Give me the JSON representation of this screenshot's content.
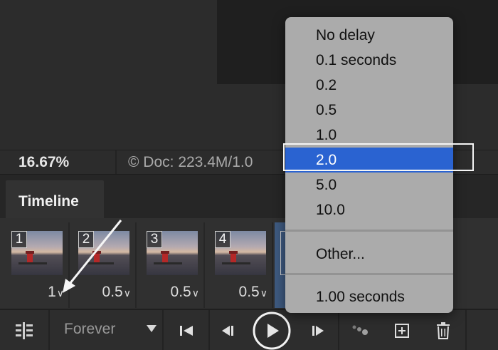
{
  "status": {
    "zoom": "16.67%",
    "doc_info": "© Doc: 223.4M/1.0"
  },
  "timeline": {
    "tab_label": "Timeline",
    "frames": [
      {
        "number": "1",
        "delay": "1"
      },
      {
        "number": "2",
        "delay": "0.5"
      },
      {
        "number": "3",
        "delay": "0.5"
      },
      {
        "number": "4",
        "delay": "0.5"
      }
    ],
    "delay_chevron": "∨",
    "loop_label": "Forever"
  },
  "delay_menu": {
    "items": [
      "No delay",
      "0.1 seconds",
      "0.2",
      "0.5",
      "1.0",
      "2.0",
      "5.0",
      "10.0"
    ],
    "selected": "2.0",
    "other": "Other...",
    "current": "1.00 seconds"
  },
  "icons": {
    "panel_menu": "panel-menu-icon",
    "loop_caret": "caret-down-icon",
    "first_frame": "first-frame-icon",
    "previous_frame": "previous-frame-icon",
    "play": "play-icon",
    "next_frame": "next-frame-icon",
    "tween": "tween-icon",
    "new_frame": "new-frame-icon",
    "delete": "trash-icon"
  },
  "colors": {
    "selection": "#2a63d1",
    "menu_bg": "#ababab",
    "panel_bg": "#323232"
  }
}
